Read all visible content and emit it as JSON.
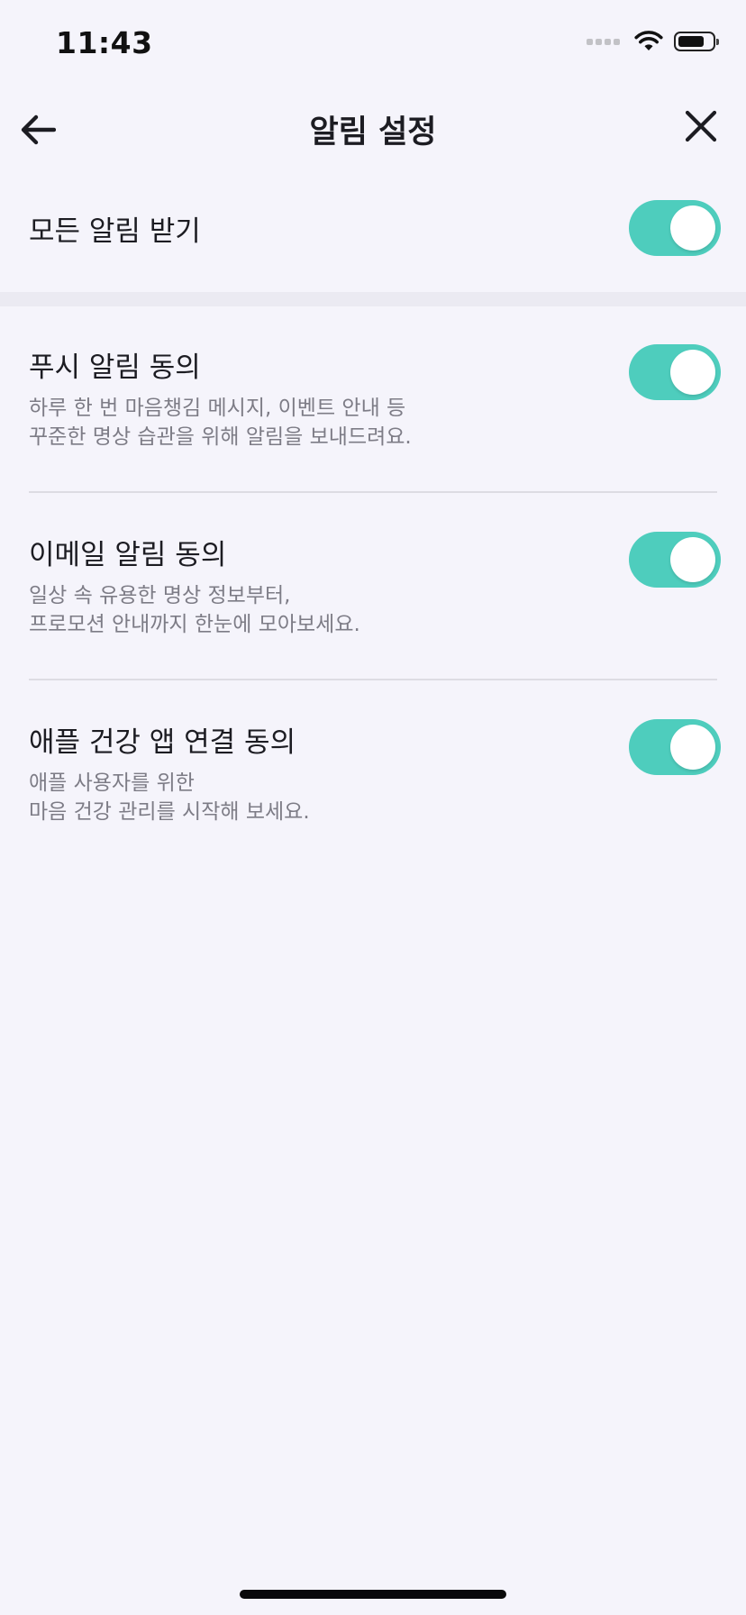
{
  "status_bar": {
    "time": "11:43",
    "icons": [
      "signal-dots-icon",
      "wifi-icon",
      "battery-icon"
    ]
  },
  "nav": {
    "title": "알림 설정",
    "back_icon": "arrow-left-icon",
    "close_icon": "close-icon"
  },
  "all_notifications": {
    "label": "모든 알림 받기",
    "enabled": true
  },
  "settings": [
    {
      "label": "푸시 알림 동의",
      "description_lines": [
        "하루 한 번 마음챙김 메시지, 이벤트 안내 등",
        "꾸준한 명상 습관을 위해 알림을 보내드려요."
      ],
      "enabled": true
    },
    {
      "label": "이메일 알림 동의",
      "description_lines": [
        "일상 속 유용한 명상 정보부터,",
        "프로모션 안내까지 한눈에 모아보세요."
      ],
      "enabled": true
    },
    {
      "label": "애플 건강 앱 연결 동의",
      "description_lines": [
        "애플 사용자를 위한",
        "마음 건강 관리를 시작해 보세요."
      ],
      "enabled": true
    }
  ],
  "colors": {
    "background": "#f5f4fb",
    "toggle_on": "#4ecdbd",
    "divider": "#dddce3",
    "description_text": "#7d7c86"
  }
}
